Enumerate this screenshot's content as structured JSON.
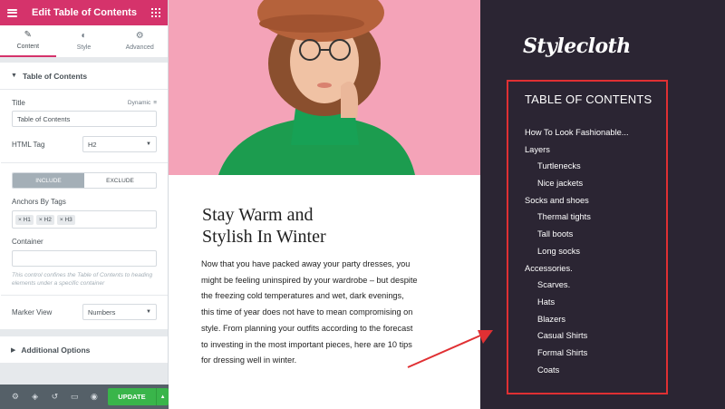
{
  "panel": {
    "title": "Edit Table of Contents",
    "tabs": [
      {
        "label": "Content",
        "icon": "pencil-icon"
      },
      {
        "label": "Style",
        "icon": "contrast-icon"
      },
      {
        "label": "Advanced",
        "icon": "gear-icon"
      }
    ],
    "section_title": "Table of Contents",
    "title_label": "Title",
    "dynamic_label": "Dynamic",
    "title_value": "Table of Contents",
    "html_tag_label": "HTML Tag",
    "html_tag_value": "H2",
    "include_label": "INCLUDE",
    "exclude_label": "EXCLUDE",
    "anchors_label": "Anchors By Tags",
    "anchor_tags": [
      "H1",
      "H2",
      "H3"
    ],
    "container_label": "Container",
    "container_value": "",
    "help_text": "This control confines the Table of Contents to heading elements under a specific container",
    "marker_view_label": "Marker View",
    "marker_view_value": "Numbers",
    "additional_options": "Additional Options",
    "update_label": "UPDATE",
    "accent_color": "#d5336b",
    "update_color": "#39b54a"
  },
  "article": {
    "headline_line1": "Stay Warm and",
    "headline_line2": "Stylish In Winter",
    "body": "Now that you have packed away your party dresses, you might be feeling uninspired by your wardrobe – but despite the freezing cold temperatures and wet, dark evenings, this time of year does not have to mean compromising on style. From planning your outfits according to the forecast to investing in the most important pieces, here are 10 tips for dressing well in winter."
  },
  "sidebar": {
    "logo": "Stylecloth",
    "toc_title": "TABLE OF CONTENTS",
    "toc_items": [
      {
        "label": "How To Look Fashionable...",
        "level": 1
      },
      {
        "label": "Layers",
        "level": 1
      },
      {
        "label": "Turtlenecks",
        "level": 2
      },
      {
        "label": "Nice jackets",
        "level": 2
      },
      {
        "label": "Socks and shoes",
        "level": 1
      },
      {
        "label": "Thermal tights",
        "level": 2
      },
      {
        "label": "Tall boots",
        "level": 2
      },
      {
        "label": "Long socks",
        "level": 2
      },
      {
        "label": "Accessories.",
        "level": 1
      },
      {
        "label": "Scarves.",
        "level": 2
      },
      {
        "label": "Hats",
        "level": 2
      },
      {
        "label": "Blazers",
        "level": 2
      },
      {
        "label": "Casual Shirts",
        "level": 2
      },
      {
        "label": "Formal Shirts",
        "level": 2
      },
      {
        "label": "Coats",
        "level": 2
      }
    ],
    "highlight_color": "#e03033",
    "background_color": "#2b2533"
  }
}
